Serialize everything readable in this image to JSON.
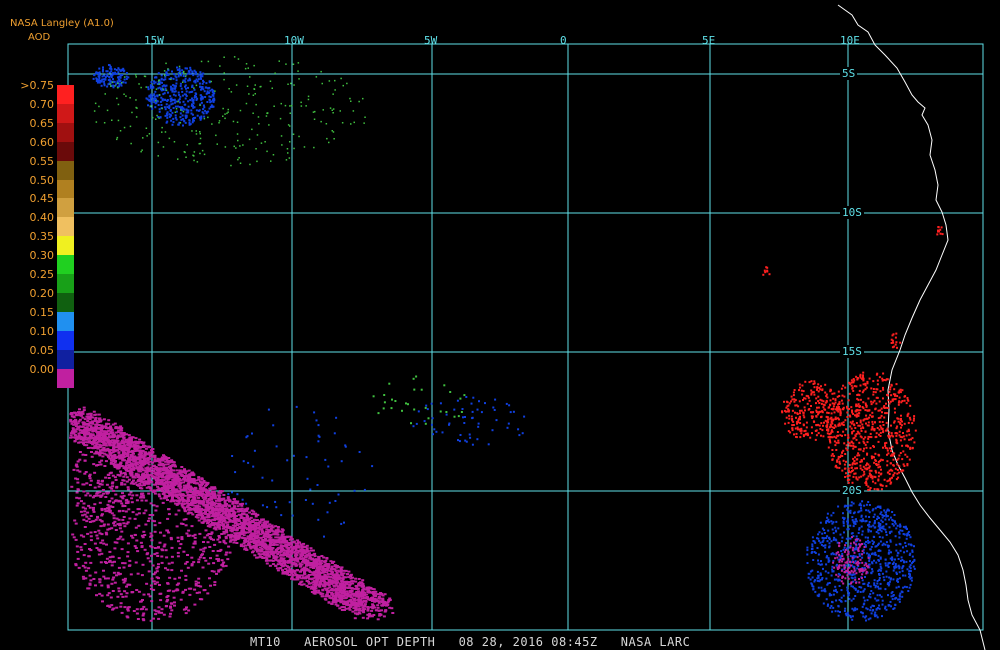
{
  "header": {
    "source": "NASA Langley (A1.0)",
    "product": "AOD"
  },
  "legend": {
    "labels": [
      ">0.75",
      "0.70",
      "0.65",
      "0.60",
      "0.55",
      "0.50",
      "0.45",
      "0.40",
      "0.35",
      "0.30",
      "0.25",
      "0.20",
      "0.15",
      "0.10",
      "0.05",
      "0.00"
    ],
    "colors": [
      "#ff2020",
      "#d01818",
      "#a01010",
      "#6a0a0a",
      "#806010",
      "#b08020",
      "#d0a040",
      "#f0c060",
      "#f0f020",
      "#20d020",
      "#18a018",
      "#106010",
      "#2090f0",
      "#1030f0",
      "#1020a0",
      "#c020a0"
    ]
  },
  "grid": {
    "lon_labels": [
      "15W",
      "10W",
      "5W",
      "0",
      "5E",
      "10E"
    ],
    "lat_labels": [
      "5S",
      "10S",
      "15S",
      "20S"
    ]
  },
  "footer": {
    "text": "MT10   AEROSOL OPT DEPTH   08 28, 2016 08:45Z   NASA LARC"
  },
  "colors": {
    "grid": "#5fe0e8",
    "coast": "#ffffff",
    "aod_high": "#ff2020",
    "aod_low": "#c020a0",
    "aod_blue": "#1040e0",
    "aod_green": "#40c040"
  }
}
